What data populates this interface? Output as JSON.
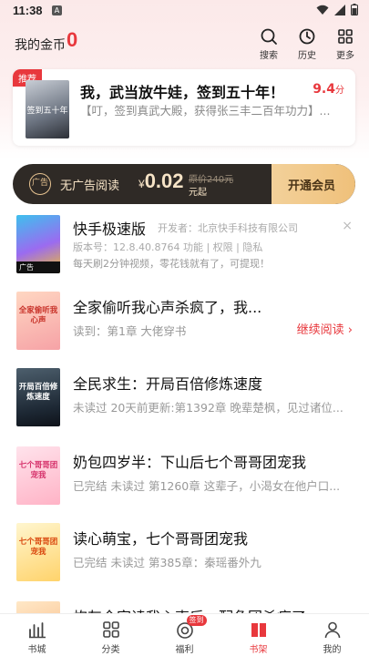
{
  "status": {
    "time": "11:38",
    "a_icon": "A"
  },
  "header": {
    "coins_label": "我的金币",
    "coins_value": "0",
    "search_label": "搜索",
    "history_label": "历史",
    "more_label": "更多"
  },
  "recommend": {
    "tag": "推荐",
    "cover_text": "签到五十年",
    "title": "我，武当放牛娃，签到五十年！",
    "score": "9.4",
    "score_unit": "分",
    "desc": "【叮，签到真武大殿，获得张三丰二百年功力】..."
  },
  "vip_bar": {
    "no_ad_label": "无广告阅读",
    "currency": "¥",
    "price": "0.02",
    "original_price": "原价240元",
    "per_unit": "元起",
    "open_label": "开通会员",
    "ad_icon_text": "广告"
  },
  "ad": {
    "app_name": "快手极速版",
    "developer": "开发者：北京快手科技有限公司",
    "version_line": "版本号：12.8.40.8764    功能 | 权限 | 隐私",
    "slogan": "每天刷2分钟视频，零花钱就有了，可提现！",
    "ad_label": "广告",
    "close": "×"
  },
  "books": [
    {
      "title": "全家偷听我心声杀疯了，我...",
      "subtitle": "读到：第1章 大佬穿书",
      "action": "继续阅读 ›",
      "cover_text": "全家偷听我心声"
    },
    {
      "title": "全民求生：开局百倍修炼速度",
      "subtitle": "未读过 20天前更新:第1392章 晚辈楚枫，见过诸位...",
      "action": "",
      "cover_text": "开局百倍修炼速度"
    },
    {
      "title": "奶包四岁半：下山后七个哥哥团宠我",
      "subtitle": "已完结 未读过 第1260章 这辈子，小渴女在他户口...",
      "action": "",
      "cover_text": "七个哥哥团宠我"
    },
    {
      "title": "读心萌宝，七个哥哥团宠我",
      "subtitle": "已完结 未读过 第385章：秦瑶番外九",
      "action": "",
      "cover_text": "七个哥哥团宠我"
    },
    {
      "title": "炮灰全家读我心声后，配角团杀疯了",
      "subtitle": "",
      "action": "",
      "cover_text": ""
    }
  ],
  "tabs": [
    {
      "label": "书城",
      "icon": "bookstore-icon"
    },
    {
      "label": "分类",
      "icon": "category-icon"
    },
    {
      "label": "福利",
      "icon": "welfare-icon",
      "badge": "签到"
    },
    {
      "label": "书架",
      "icon": "bookshelf-icon"
    },
    {
      "label": "我的",
      "icon": "profile-icon"
    }
  ],
  "colors": {
    "accent": "#e8383d",
    "vip_dark": "#2f2a26",
    "vip_gold": "#f3d19a"
  }
}
